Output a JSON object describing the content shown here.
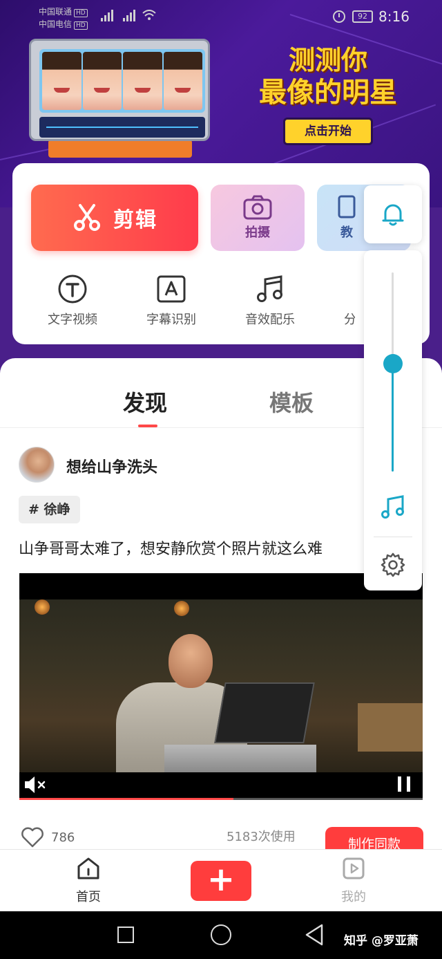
{
  "status_bar": {
    "carrier1": "中国联通",
    "carrier2": "中国电信",
    "hd": "HD",
    "battery": "92",
    "time": "8:16"
  },
  "banner": {
    "title_line1": "测测你",
    "title_line2": "最像的明星",
    "cta": "点击开始"
  },
  "tools": {
    "edit_label": "剪辑",
    "shoot_label": "拍摄",
    "tutorial_label": "教",
    "row": [
      {
        "label": "文字视频",
        "icon": "text-t-icon"
      },
      {
        "label": "字幕识别",
        "icon": "subtitle-a-icon"
      },
      {
        "label": "音效配乐",
        "icon": "music-note-icon"
      },
      {
        "label": "分割",
        "icon": "split-icon"
      }
    ]
  },
  "feed": {
    "tabs": [
      {
        "label": "发现",
        "active": true
      },
      {
        "label": "模板",
        "active": false
      }
    ],
    "post": {
      "username": "想给山争洗头",
      "hashtag": "# 徐峥",
      "caption": "山争哥哥太难了，想安静欣赏个照片就这么难",
      "progress": 0.53,
      "likes": "786",
      "use_count": "5183次使用",
      "make_label": "制作同款"
    }
  },
  "bottom_nav": {
    "home_label": "首页",
    "add_label": "+",
    "mine_label": "我的"
  },
  "floating_panel": {
    "volume": 0.54,
    "accent": "#1aa7c7"
  },
  "watermark": "知乎 @罗亚萧"
}
